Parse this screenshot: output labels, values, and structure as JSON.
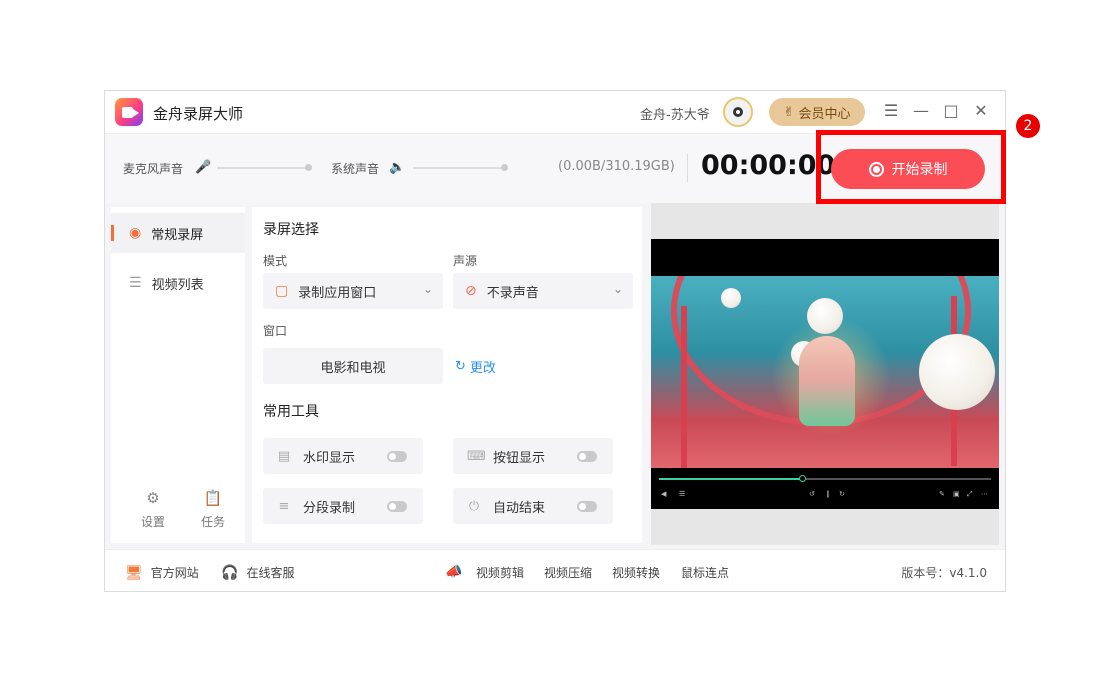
{
  "app": {
    "title": "金舟录屏大师",
    "username": "金舟-苏大爷",
    "vip_label": "会员中心",
    "window_controls": [
      "menu-icon",
      "minimize-icon",
      "maximize-icon",
      "close-icon"
    ]
  },
  "toolbar": {
    "mic_label": "麦克风声音",
    "system_label": "系统声音",
    "storage": "(0.00B/310.19GB)",
    "timer": "00:00:00",
    "record_label": "开始录制"
  },
  "sidebar": {
    "items": [
      {
        "label": "常规录屏",
        "icon": "camera-icon",
        "active": true
      },
      {
        "label": "视频列表",
        "icon": "list-icon",
        "active": false
      }
    ],
    "settings_label": "设置",
    "tasks_label": "任务"
  },
  "main": {
    "section_title": "录屏选择",
    "mode_label": "模式",
    "mode_value": "录制应用窗口",
    "audio_label": "声源",
    "audio_value": "不录声音",
    "window_label": "窗口",
    "window_value": "电影和电视",
    "change_label": "更改",
    "tools_title": "常用工具",
    "tools": [
      {
        "label": "水印显示",
        "icon": "watermark-icon",
        "on": false
      },
      {
        "label": "按钮显示",
        "icon": "keyboard-icon",
        "on": false
      },
      {
        "label": "分段录制",
        "icon": "segment-icon",
        "on": false
      },
      {
        "label": "自动结束",
        "icon": "power-icon",
        "on": false
      }
    ]
  },
  "preview": {
    "progress": 0.43
  },
  "footer": {
    "website_label": "官方网站",
    "service_label": "在线客服",
    "links": [
      "视频剪辑",
      "视频压缩",
      "视频转换",
      "鼠标连点"
    ],
    "version": "版本号：v4.1.0"
  },
  "annotation": {
    "badge": "2",
    "color": "#ff0000"
  },
  "colors": {
    "accent": "#fa4d55",
    "vip": "#e8c898",
    "link": "#2a8ef0"
  }
}
